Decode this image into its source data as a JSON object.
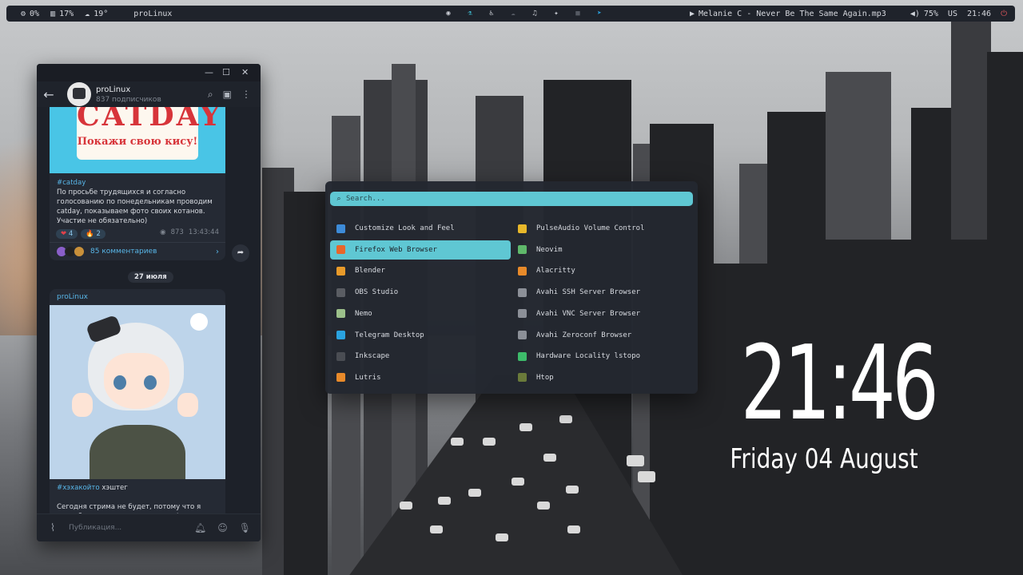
{
  "topbar": {
    "cpu": "0%",
    "mem": "17%",
    "weather": "19°",
    "title": "proLinux",
    "now_playing": "Melanie C - Never Be The Same Again.mp3",
    "volume": "75%",
    "layout": "US",
    "time": "21:46",
    "tray_icons": [
      "chromium-icon",
      "flask-icon",
      "accessibility-icon",
      "cloud-icon",
      "headphones-icon",
      "gamepad-icon",
      "camera-icon",
      "telegram-icon"
    ]
  },
  "telegram": {
    "channel_name": "proLinux",
    "subscribers": "837 подписчиков",
    "post1": {
      "image_title": "CATDAY",
      "image_subtitle": "Покажи свою кису!",
      "hashtag": "#catday",
      "text": "По просьбе трудящихся и согласно голосованию по понедельникам проводим catday, показываем фото своих котанов. Участие не обязательно)",
      "reactions": [
        {
          "emoji": "❤",
          "count": "4"
        },
        {
          "emoji": "🔥",
          "count": "2"
        }
      ],
      "views": "873",
      "time": "13:43:44",
      "comments": "85 комментариев"
    },
    "date_separator": "27 июля",
    "post2": {
      "author": "proLinux",
      "hashtag": "#хэхакойто",
      "hashtag_suffix": " хэштег",
      "text": "Сегодня стрима не будет, потому что я задолбался и ничего не успеваю!"
    },
    "composer_placeholder": "Публикация..."
  },
  "launcher": {
    "search_placeholder": "Search...",
    "apps_left": [
      {
        "label": "Customize Look and Feel",
        "icon": "settings-icon",
        "color": "#3d8bd8"
      },
      {
        "label": "Firefox Web Browser",
        "icon": "firefox-icon",
        "color": "#e8662a"
      },
      {
        "label": "Blender",
        "icon": "blender-icon",
        "color": "#e89a2a"
      },
      {
        "label": "OBS Studio",
        "icon": "obs-icon",
        "color": "#5a5d63"
      },
      {
        "label": "Nemo",
        "icon": "folder-icon",
        "color": "#9cc08a"
      },
      {
        "label": "Telegram Desktop",
        "icon": "telegram-icon",
        "color": "#2aa3e0"
      },
      {
        "label": "Inkscape",
        "icon": "inkscape-icon",
        "color": "#4a4d53"
      },
      {
        "label": "Lutris",
        "icon": "lutris-icon",
        "color": "#e88a2a"
      }
    ],
    "apps_right": [
      {
        "label": "PulseAudio Volume Control",
        "icon": "speaker-icon",
        "color": "#e8b82a"
      },
      {
        "label": "Neovim",
        "icon": "neovim-icon",
        "color": "#5fb86a"
      },
      {
        "label": "Alacritty",
        "icon": "terminal-icon",
        "color": "#e88a2a"
      },
      {
        "label": "Avahi SSH Server Browser",
        "icon": "monitor-icon",
        "color": "#8c9098"
      },
      {
        "label": "Avahi VNC Server Browser",
        "icon": "monitor-icon",
        "color": "#8c9098"
      },
      {
        "label": "Avahi Zeroconf Browser",
        "icon": "monitor-icon",
        "color": "#8c9098"
      },
      {
        "label": "Hardware Locality lstopo",
        "icon": "chip-icon",
        "color": "#3dbb6a"
      },
      {
        "label": "Htop",
        "icon": "htop-icon",
        "color": "#6a7a3a"
      }
    ],
    "selected": "Firefox Web Browser"
  },
  "clock": {
    "time": "21:46",
    "date": "Friday 04 August"
  }
}
